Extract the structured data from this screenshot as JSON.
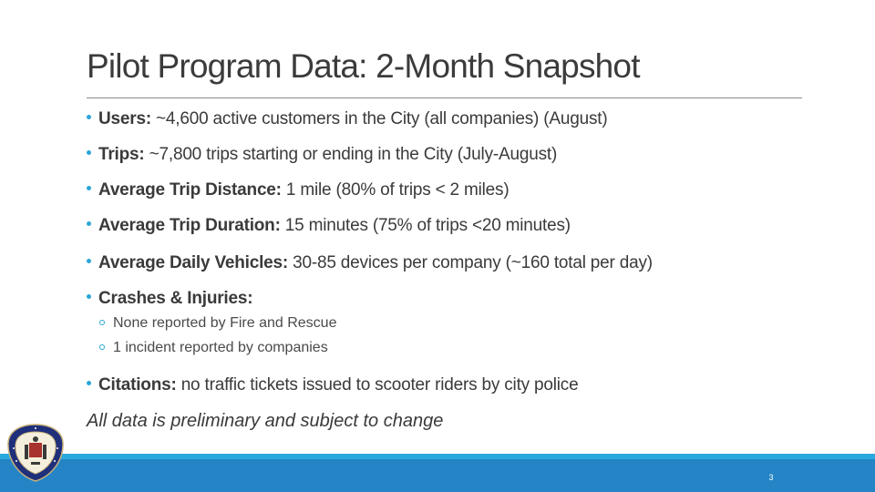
{
  "slide": {
    "title": "Pilot Program Data: 2-Month Snapshot",
    "bullets": [
      {
        "label": "Users:",
        "text": " ~4,600 active customers in the City (all companies) (August)"
      },
      {
        "label": "Trips:",
        "text": " ~7,800 trips starting or ending in the City (July-August)"
      },
      {
        "label": "Average Trip Distance:",
        "text": " 1 mile (80% of trips < 2 miles)"
      },
      {
        "label": "Average Trip Duration:",
        "text": " 15 minutes (75% of trips <20 minutes)"
      },
      {
        "label": "Average Daily Vehicles:",
        "text": " 30-85 devices per company (~160 total per day)"
      },
      {
        "label": "Crashes & Injuries:",
        "text": ""
      },
      {
        "label": "Citations:",
        "text": " no traffic tickets issued to scooter riders by city police"
      }
    ],
    "sub_bullets": [
      "None reported by Fire and Rescue",
      "1 incident reported by companies"
    ],
    "note": "All data is preliminary and subject to change",
    "page_number": "3",
    "seal_icon": "city-seal-icon"
  },
  "colors": {
    "bullet_accent": "#2aa6d6",
    "footer_light": "#29a9df",
    "footer_dark": "#2484c6",
    "seal_blue": "#1f2f7a"
  }
}
